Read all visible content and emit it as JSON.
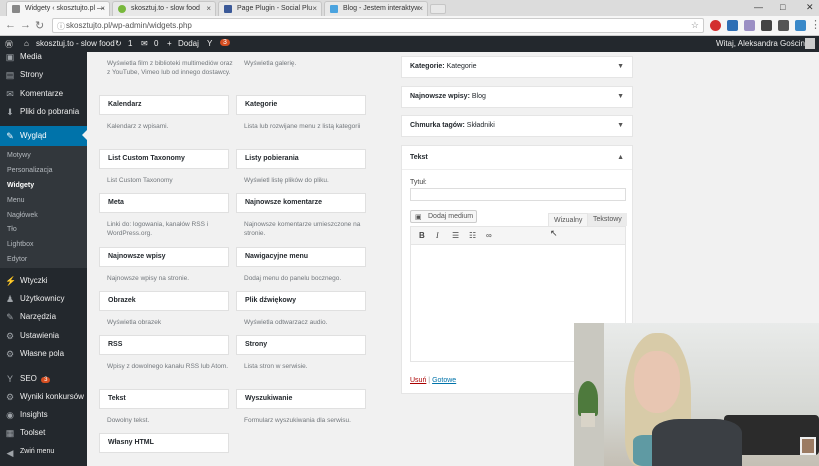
{
  "browser": {
    "tabs": [
      {
        "title": "Widgety ‹ skosztujto.pl — ",
        "favicon_color": "#888888",
        "active": true
      },
      {
        "title": "skosztuj.to - slow food",
        "favicon_color": "#78b83c",
        "active": false
      },
      {
        "title": "Page Plugin - Social Plu",
        "favicon_color": "#3b5998",
        "active": false
      },
      {
        "title": "Blog - Jestem interaktyw",
        "favicon_color": "#4aa3df",
        "active": false
      }
    ],
    "url": "skosztujto.pl/wp-admin/widgets.php",
    "win_controls": [
      "—",
      "□",
      "✕"
    ]
  },
  "adminbar": {
    "site_name": "skosztuj.to - slow food",
    "updates_count": "1",
    "comments_count": "0",
    "new_label": "Dodaj",
    "yoast_count": "3",
    "greeting": "Witaj, Aleksandra Gościniak"
  },
  "sidebar": {
    "items": [
      {
        "label": "Media",
        "icon": "media-icon",
        "glyph": "▣"
      },
      {
        "label": "Strony",
        "icon": "pages-icon",
        "glyph": "▤"
      },
      {
        "label": "Komentarze",
        "icon": "comments-icon",
        "glyph": "✉"
      },
      {
        "label": "Pliki do pobrania",
        "icon": "download-icon",
        "glyph": "⬇"
      },
      {
        "label": "Wygląd",
        "icon": "appearance-icon",
        "glyph": "✎",
        "active": true
      }
    ],
    "submenu": [
      "Motywy",
      "Personalizacja",
      "Widgety",
      "Menu",
      "Nagłówek",
      "Tło",
      "Lightbox",
      "Edytor"
    ],
    "submenu_current": "Widgety",
    "items_bottom": [
      {
        "label": "Wtyczki",
        "icon": "plugins-icon",
        "glyph": "⚡"
      },
      {
        "label": "Użytkownicy",
        "icon": "users-icon",
        "glyph": "👤"
      },
      {
        "label": "Narzędzia",
        "icon": "tools-icon",
        "glyph": "🔧"
      },
      {
        "label": "Ustawienia",
        "icon": "settings-icon",
        "glyph": "⚙"
      },
      {
        "label": "Własne pola",
        "icon": "custom-fields-icon",
        "glyph": "⚙"
      },
      {
        "label": "SEO",
        "icon": "seo-icon",
        "glyph": "Y",
        "badge": "3"
      },
      {
        "label": "Wyniki konkursów",
        "icon": "contest-icon",
        "glyph": "⚙"
      },
      {
        "label": "Insights",
        "icon": "insights-icon",
        "glyph": "◉"
      },
      {
        "label": "Toolset",
        "icon": "toolset-icon",
        "glyph": "▦"
      },
      {
        "label": "Zwiń menu",
        "icon": "collapse-icon",
        "glyph": "◀"
      }
    ]
  },
  "widgets": {
    "top_desc_left": "Wyświetla film z biblioteki multimediów oraz z YouTube, Vimeo lub od innego dostawcy.",
    "top_desc_right": "Wyświetla galerię.",
    "rows": [
      [
        {
          "name": "Kalendarz",
          "desc": "Kalendarz z wpisami."
        },
        {
          "name": "Kategorie",
          "desc": "Lista lub rozwijane menu z listą kategorii"
        }
      ],
      [
        {
          "name": "List Custom Taxonomy",
          "desc": "List Custom Taxonomy"
        },
        {
          "name": "Listy pobierania",
          "desc": "Wyświetl listę plików do pliku."
        }
      ],
      [
        {
          "name": "Meta",
          "desc": "Linki do: logowania, kanałów RSS i WordPress.org."
        },
        {
          "name": "Najnowsze komentarze",
          "desc": "Najnowsze komentarze umieszczone na stronie."
        }
      ],
      [
        {
          "name": "Najnowsze wpisy",
          "desc": "Najnowsze wpisy na stronie."
        },
        {
          "name": "Nawigacyjne menu",
          "desc": "Dodaj menu do panelu bocznego."
        }
      ],
      [
        {
          "name": "Obrazek",
          "desc": "Wyświetla obrazek"
        },
        {
          "name": "Plik dźwiękowy",
          "desc": "Wyświetla odtwarzacz audio."
        }
      ],
      [
        {
          "name": "RSS",
          "desc": "Wpisy z dowolnego kanału RSS lub Atom."
        },
        {
          "name": "Strony",
          "desc": "Lista stron w serwisie."
        }
      ],
      [
        {
          "name": "Tekst",
          "desc": "Dowolny tekst."
        },
        {
          "name": "Wyszukiwanie",
          "desc": "Formularz wyszukiwania dla serwisu."
        }
      ],
      [
        {
          "name": "Własny HTML",
          "desc": ""
        },
        null
      ]
    ]
  },
  "widget_area": {
    "items": [
      {
        "label": "Kategorie:",
        "value": "Kategorie"
      },
      {
        "label": "Najnowsze wpisy:",
        "value": "Blog"
      },
      {
        "label": "Chmurka tagów:",
        "value": "Składniki"
      }
    ],
    "text_widget": {
      "title": "Tekst",
      "field_label": "Tytuł:",
      "field_value": "",
      "add_media": "Dodaj medium",
      "tab_visual": "Wizualny",
      "tab_text": "Tekstowy",
      "delete": "Usuń",
      "separator": "|",
      "done": "Gotowe"
    }
  }
}
